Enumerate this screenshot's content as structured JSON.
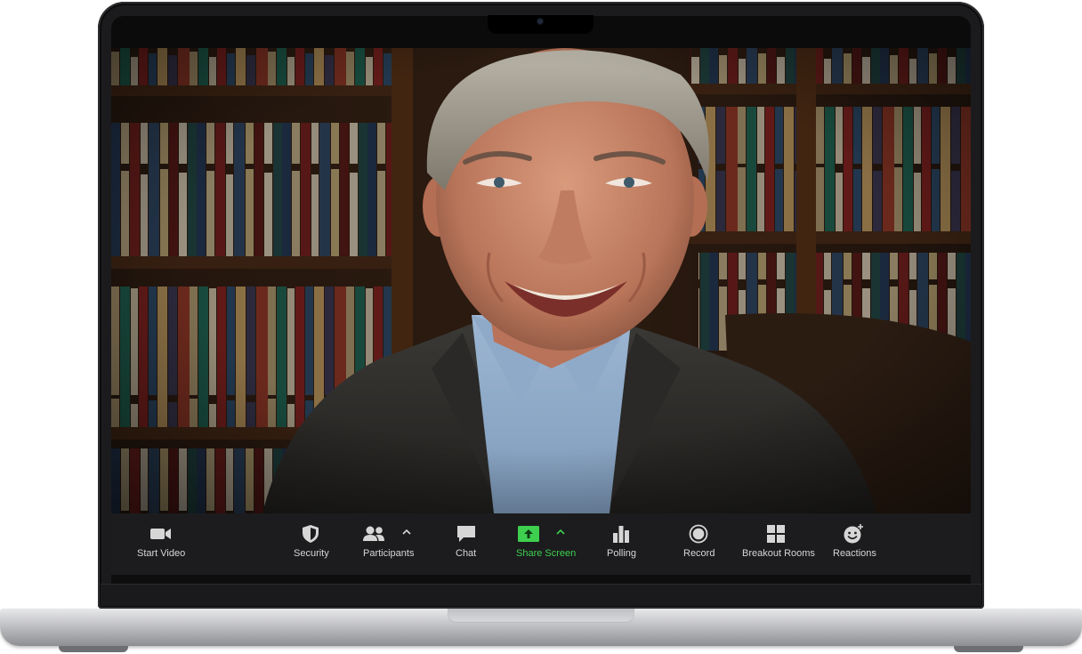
{
  "toolbar": {
    "items": [
      {
        "label": "Start Video",
        "icon": "video-camera-icon"
      },
      {
        "label": "Security",
        "icon": "shield-icon"
      },
      {
        "label": "Participants",
        "icon": "participants-icon",
        "has_caret": true
      },
      {
        "label": "Chat",
        "icon": "chat-bubble-icon"
      },
      {
        "label": "Share Screen",
        "icon": "share-screen-icon",
        "has_caret": true,
        "accent": "#3ecf4f"
      },
      {
        "label": "Polling",
        "icon": "bar-chart-icon"
      },
      {
        "label": "Record",
        "icon": "record-icon"
      },
      {
        "label": "Breakout Rooms",
        "icon": "grid-icon"
      },
      {
        "label": "Reactions",
        "icon": "emoji-add-icon"
      }
    ]
  },
  "colors": {
    "toolbar_bg": "#1c1c1e",
    "label_text": "#d6d6d6",
    "share_accent": "#3ecf4f",
    "laptop_frame": "#1b1b1d",
    "laptop_base": "#c9cacd"
  }
}
